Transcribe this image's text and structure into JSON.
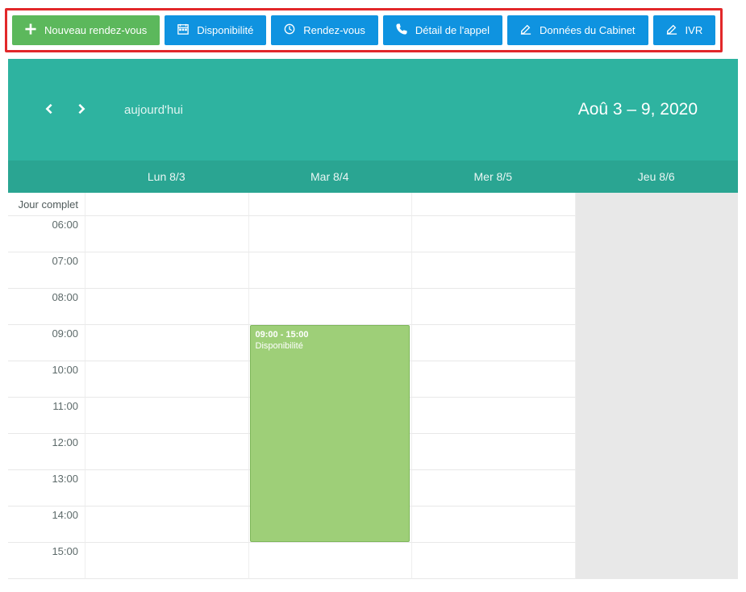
{
  "toolbar": {
    "new_appointment": "Nouveau rendez-vous",
    "availability": "Disponibilité",
    "appointments": "Rendez-vous",
    "call_detail": "Détail de l'appel",
    "cabinet_data": "Données du Cabinet",
    "ivr": "IVR"
  },
  "calendar": {
    "today_label": "aujourd'hui",
    "range_label": "Aoû 3 – 9, 2020",
    "allday_label": "Jour complet",
    "days": [
      {
        "label": "Lun 8/3",
        "disabled": false
      },
      {
        "label": "Mar 8/4",
        "disabled": false
      },
      {
        "label": "Mer 8/5",
        "disabled": false
      },
      {
        "label": "Jeu 8/6",
        "disabled": true
      }
    ],
    "hours": [
      "06:00",
      "07:00",
      "08:00",
      "09:00",
      "10:00",
      "11:00",
      "12:00",
      "13:00",
      "14:00",
      "15:00"
    ],
    "event": {
      "day_index": 1,
      "time_label": "09:00 - 15:00",
      "title": "Disponibilité",
      "start_hour_index": 3,
      "end_hour_index": 9
    }
  }
}
